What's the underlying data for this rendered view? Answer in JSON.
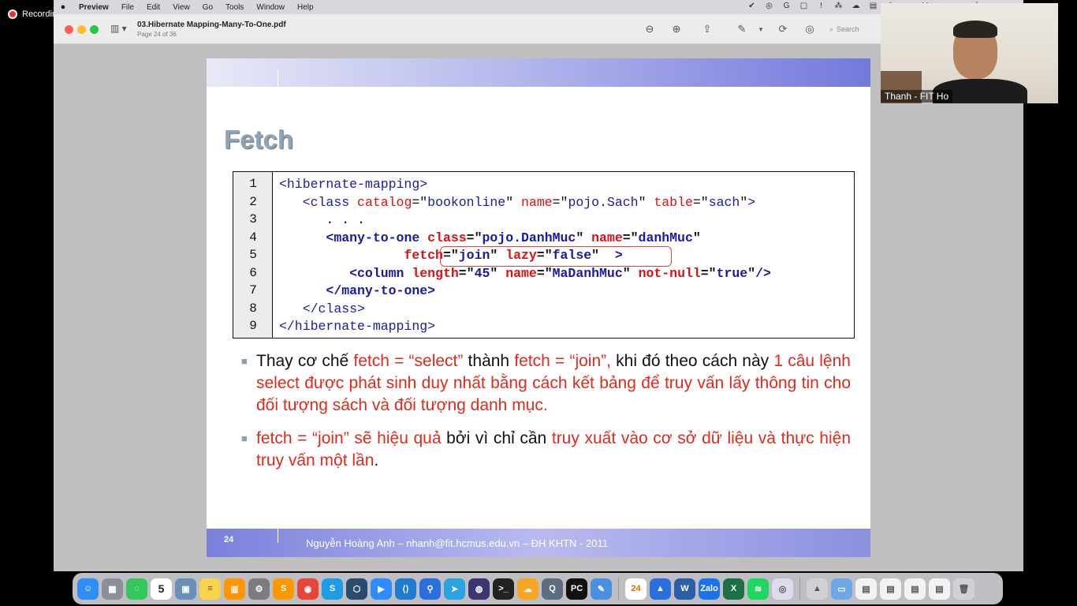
{
  "recording": {
    "label": "Recording"
  },
  "menubar": {
    "app": "Preview",
    "items": [
      "File",
      "Edit",
      "View",
      "Go",
      "Tools",
      "Window",
      "Help"
    ]
  },
  "window": {
    "doc_title": "03.Hibernate Mapping-Many-To-One.pdf",
    "page_info": "Page 24 of 36",
    "search_placeholder": "Search"
  },
  "slide": {
    "title": "Fetch",
    "line_numbers": [
      "1",
      "2",
      "3",
      "4",
      "5",
      "6",
      "7",
      "8",
      "9"
    ],
    "code": {
      "l1_tag": "<hibernate-mapping>",
      "l2_open": "<class",
      "l2_a1": "catalog",
      "l2_v1": "bookonline",
      "l2_a2": "name",
      "l2_v2": "pojo.Sach",
      "l2_a3": "table",
      "l2_v3": "sach",
      "l2_close": ">",
      "l3_dots": ". . .",
      "l4_open": "<many-to-one",
      "l4_a1": "class",
      "l4_v1": "pojo.DanhMuc",
      "l4_a2": "name",
      "l4_v2": "danhMuc",
      "l5_a1": "fetch",
      "l5_v1": "join",
      "l5_a2": "lazy",
      "l5_v2": "false",
      "l5_close": ">",
      "l6_open": "<column",
      "l6_a1": "length",
      "l6_v1": "45",
      "l6_a2": "name",
      "l6_v2": "MaDanhMuc",
      "l6_a3": "not-null",
      "l6_v3": "true",
      "l6_close": "/>",
      "l7_tag": "</many-to-one>",
      "l8_tag": "</class>",
      "l9_tag": "</hibernate-mapping>"
    },
    "bullet1": {
      "t1": "Thay cơ chế ",
      "r1": "fetch = “select”",
      "t2": "  thành ",
      "r2": "fetch = “join”,",
      "t3": "  khi đó theo cách này ",
      "r3": "1 câu lệnh select được phát sinh duy nhất bằng cách kết bảng để truy vấn lấy thông tin cho đối tượng sách và đối tượng danh mục."
    },
    "bullet2": {
      "r1": "fetch = “join”  sẽ hiệu quả",
      "t1": " bởi vì chỉ cần ",
      "r2": "truy xuất vào cơ sở dữ liệu và thực hiện truy vấn một lần",
      "t2": "."
    },
    "page_number": "24",
    "footer": "Nguyễn Hoàng Anh – nhanh@fit.hcmus.edu.vn – ĐH KHTN - 2011"
  },
  "webcam": {
    "name": "Thanh - FIT Ho"
  },
  "dock": {
    "calendar_day": "5",
    "apps": [
      {
        "name": "finder",
        "color": "#2f8ef5",
        "glyph": "☺"
      },
      {
        "name": "launchpad",
        "color": "#8a8f99",
        "glyph": "▦"
      },
      {
        "name": "messages",
        "color": "#34c759",
        "glyph": "◌"
      },
      {
        "name": "calendar",
        "color": "#ffffff",
        "glyph": ""
      },
      {
        "name": "preview",
        "color": "#6a8fb8",
        "glyph": "▣"
      },
      {
        "name": "notes",
        "color": "#f7d44a",
        "glyph": "≡"
      },
      {
        "name": "books",
        "color": "#ff9500",
        "glyph": "▥"
      },
      {
        "name": "settings",
        "color": "#7b7b80",
        "glyph": "⚙"
      },
      {
        "name": "sublime",
        "color": "#ff9800",
        "glyph": "S"
      },
      {
        "name": "chrome",
        "color": "#e8443a",
        "glyph": "◉"
      },
      {
        "name": "skype",
        "color": "#1e9de6",
        "glyph": "S"
      },
      {
        "name": "network",
        "color": "#2a4b6e",
        "glyph": "⬡"
      },
      {
        "name": "zoom",
        "color": "#2d8cff",
        "glyph": "▶"
      },
      {
        "name": "vscode",
        "color": "#1f7bd0",
        "glyph": "⟨⟩"
      },
      {
        "name": "maps",
        "color": "#2a6fe0",
        "glyph": "⚲"
      },
      {
        "name": "telegram",
        "color": "#2aa3e0",
        "glyph": "➤"
      },
      {
        "name": "eclipse",
        "color": "#3b3573",
        "glyph": "◍"
      },
      {
        "name": "terminal",
        "color": "#222222",
        "glyph": ">_"
      },
      {
        "name": "cloudapp",
        "color": "#f5a623",
        "glyph": "☁"
      },
      {
        "name": "quicktime",
        "color": "#5d6d7e",
        "glyph": "Q"
      },
      {
        "name": "pycharm",
        "color": "#111111",
        "glyph": "PC"
      },
      {
        "name": "xcode",
        "color": "#4a90e2",
        "glyph": "✎"
      }
    ],
    "apps_right": [
      {
        "name": "notification-24",
        "color": "#ffffff",
        "glyph": "24"
      },
      {
        "name": "vpn",
        "color": "#2a6fe0",
        "glyph": "▲"
      },
      {
        "name": "word",
        "color": "#2b5faa",
        "glyph": "W"
      },
      {
        "name": "zalo",
        "color": "#1a73e8",
        "glyph": "Zalo"
      },
      {
        "name": "excel",
        "color": "#1d7044",
        "glyph": "X"
      },
      {
        "name": "spotify",
        "color": "#1ed760",
        "glyph": "≋"
      },
      {
        "name": "collab",
        "color": "#dcdcec",
        "glyph": "◎"
      }
    ],
    "apps_tail": [
      {
        "name": "app-tail-1",
        "color": "#cfcfd4",
        "glyph": "▲"
      },
      {
        "name": "downloads-folder",
        "color": "#6ea8e8",
        "glyph": "▭"
      },
      {
        "name": "doc-thumb-1",
        "color": "#f2f2f2",
        "glyph": "▤"
      },
      {
        "name": "doc-thumb-2",
        "color": "#f2f2f2",
        "glyph": "▤"
      },
      {
        "name": "doc-thumb-3",
        "color": "#f2f2f2",
        "glyph": "▤"
      },
      {
        "name": "doc-thumb-4",
        "color": "#f2f2f2",
        "glyph": "▤"
      },
      {
        "name": "trash",
        "color": "#d0d0d5",
        "glyph": "🗑"
      }
    ]
  }
}
